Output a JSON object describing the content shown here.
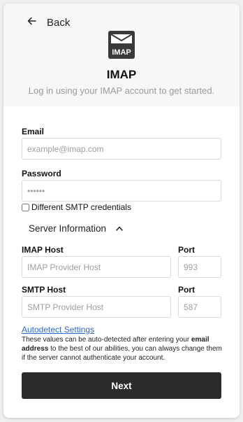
{
  "header": {
    "back_label": "Back",
    "logo_text": "IMAP",
    "title": "IMAP",
    "subtitle": "Log in using your IMAP account to get started."
  },
  "form": {
    "email": {
      "label": "Email",
      "placeholder": "example@imap.com",
      "value": ""
    },
    "password": {
      "label": "Password",
      "placeholder": "••••••",
      "value": ""
    },
    "different_smtp": {
      "label": "Different SMTP credentials",
      "checked": false
    },
    "server_info": {
      "label": "Server Information",
      "expanded": true
    },
    "imap_host": {
      "label": "IMAP Host",
      "placeholder": "IMAP Provider Host"
    },
    "imap_port": {
      "label": "Port",
      "placeholder": "993"
    },
    "smtp_host": {
      "label": "SMTP Host",
      "placeholder": "SMTP Provider Host"
    },
    "smtp_port": {
      "label": "Port",
      "placeholder": "587"
    },
    "autodetect_label": "Autodetect Settings",
    "help": {
      "part1": "These values can be auto-detected after entering your ",
      "bold": "email address",
      "part2": " to the best of our abilities, you can always change them if the server cannot authenticate your account."
    },
    "next_label": "Next"
  },
  "colors": {
    "link": "#2f68d1",
    "button_bg": "#2b2b2b",
    "header_bg": "#f7f7f7"
  }
}
